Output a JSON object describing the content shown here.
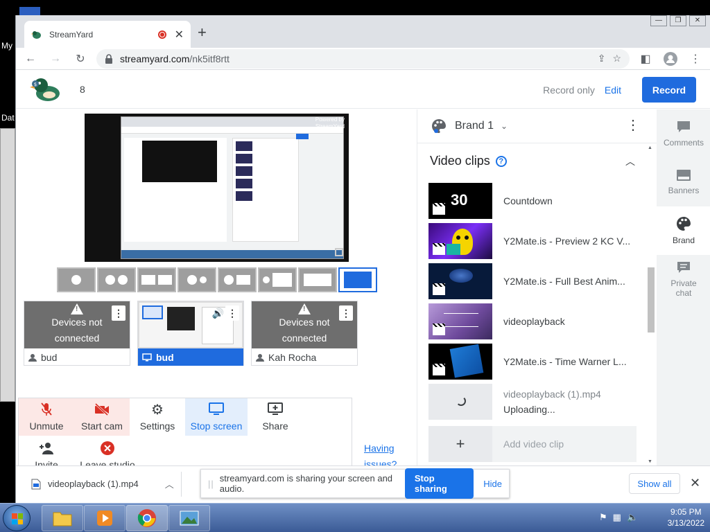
{
  "desktop": {
    "label_1": "My",
    "label_2": "Dat"
  },
  "browser": {
    "tab_title": "StreamYard",
    "url_host": "streamyard.com",
    "url_path": "/nk5itf8rtt"
  },
  "header": {
    "count": "8",
    "record_only": "Record only",
    "edit": "Edit",
    "record": "Record"
  },
  "preview": {
    "brand_line1": "Powered by",
    "brand_line2": "StreamYard"
  },
  "participants": [
    {
      "status_line1": "Devices not",
      "status_line2": "connected",
      "name": "bud"
    },
    {
      "name": "bud"
    },
    {
      "status_line1": "Devices not",
      "status_line2": "connected",
      "name": "Kah Rocha"
    }
  ],
  "controls": {
    "unmute": "Unmute",
    "start_cam": "Start cam",
    "settings": "Settings",
    "stop_screen": "Stop screen",
    "share": "Share",
    "invite": "Invite",
    "leave": "Leave studio",
    "having_issues_1": "Having",
    "having_issues_2": "issues?"
  },
  "brand_panel": {
    "brand_name": "Brand 1",
    "section_title": "Video clips",
    "clips": [
      {
        "label": "Countdown",
        "thumb_text": "30"
      },
      {
        "label": "Y2Mate.is - Preview 2 KC V..."
      },
      {
        "label": "Y2Mate.is - Full Best Anim..."
      },
      {
        "label": "videoplayback"
      },
      {
        "label": "Y2Mate.is - Time Warner L..."
      }
    ],
    "uploading_name": "videoplayback (1).mp4",
    "uploading_status": "Uploading...",
    "add_clip": "Add video clip"
  },
  "sidenav": {
    "comments": "Comments",
    "banners": "Banners",
    "brand": "Brand",
    "private_chat_1": "Private",
    "private_chat_2": "chat"
  },
  "download_bar": {
    "file": "videoplayback (1).mp4",
    "share_message": "streamyard.com is sharing your screen and audio.",
    "stop_sharing": "Stop sharing",
    "hide": "Hide",
    "show_all": "Show all"
  },
  "taskbar": {
    "time": "9:05 PM",
    "date": "3/13/2022"
  },
  "colors": {
    "accent": "#1f6bde",
    "link": "#1a73e8",
    "warning_bg": "#fce8e6"
  }
}
